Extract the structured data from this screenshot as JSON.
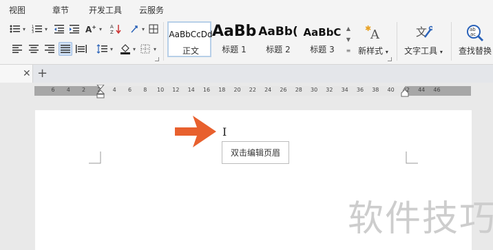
{
  "menu": {
    "items": [
      {
        "label": "视图"
      },
      {
        "label": "章节"
      },
      {
        "label": "开发工具"
      },
      {
        "label": "云服务"
      }
    ]
  },
  "ribbon": {
    "styles": [
      {
        "sample": "AaBbCcDd",
        "name": "正文"
      },
      {
        "sample": "AaBb",
        "name": "标题 1"
      },
      {
        "sample": "AaBb(",
        "name": "标题 2"
      },
      {
        "sample": "AaBbC",
        "name": "标题 3"
      }
    ],
    "new_style_label": "新样式",
    "text_tools_label": "文字工具",
    "find_replace_label": "查找替换"
  },
  "ruler": {
    "ticks": [
      "6",
      "4",
      "2",
      "2",
      "4",
      "6",
      "8",
      "10",
      "12",
      "14",
      "16",
      "18",
      "20",
      "22",
      "24",
      "26",
      "28",
      "30",
      "32",
      "34",
      "36",
      "38",
      "40",
      "42",
      "44",
      "46"
    ]
  },
  "document": {
    "tooltip": "双击编辑页眉"
  },
  "watermark": "软件技巧",
  "colors": {
    "arrow": "#e8602e",
    "active_button": "#cfe0f5",
    "ruler_dark": "#a7a7a7",
    "ruler_light": "#e6e6e6"
  }
}
